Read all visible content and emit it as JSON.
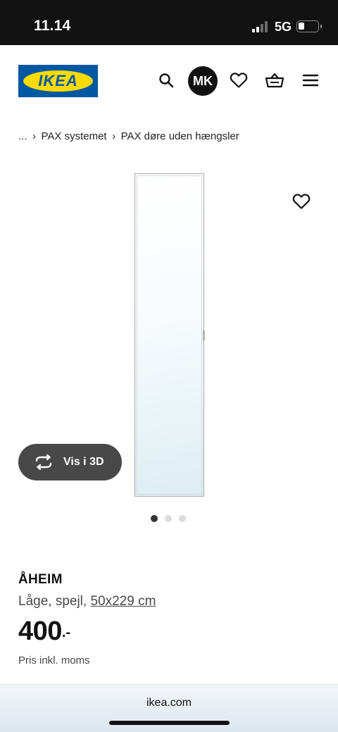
{
  "status_bar": {
    "time": "11.14",
    "network": "5G"
  },
  "header": {
    "logo_text": "IKEA",
    "avatar_initials": "MK",
    "brand_colors": {
      "blue": "#0058a3",
      "yellow": "#ffdb00"
    },
    "icons": [
      "search-icon",
      "heart-icon",
      "basket-icon",
      "menu-icon"
    ]
  },
  "breadcrumb": {
    "ellipsis": "...",
    "items": [
      "PAX systemet",
      "PAX døre uden hængsler"
    ]
  },
  "gallery": {
    "view_3d_label": "Vis i 3D",
    "slide_count": 3,
    "active_slide": 1
  },
  "product": {
    "name": "ÅHEIM",
    "description": "Låge, spejl,",
    "size": "50x229 cm",
    "price_integer": "400",
    "price_suffix": ".-",
    "price_note": "Pris inkl. moms"
  },
  "browser": {
    "url": "ikea.com"
  }
}
